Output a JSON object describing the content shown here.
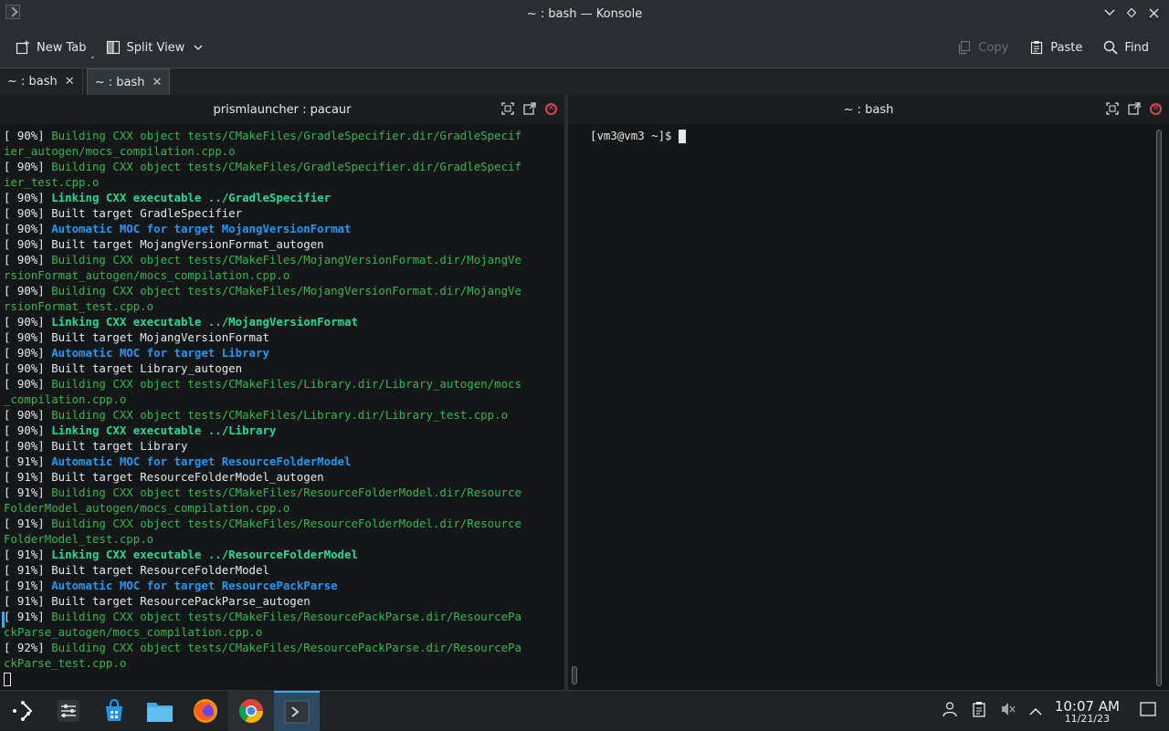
{
  "window": {
    "title": "~ : bash — Konsole"
  },
  "toolbar": {
    "new_tab": "New Tab",
    "split_view": "Split View",
    "copy": "Copy",
    "paste": "Paste",
    "find": "Find"
  },
  "tabs": [
    {
      "label": "~ : bash",
      "active": false
    },
    {
      "label": "~ : bash",
      "active": true
    }
  ],
  "left_pane": {
    "title": "prismlauncher : pacaur",
    "lines": [
      {
        "pct": "[ 90%] ",
        "text": "Building CXX object tests/CMakeFiles/GradleSpecifier.dir/GradleSpecif",
        "style": "g"
      },
      {
        "pct": "",
        "text": "ier_autogen/mocs_compilation.cpp.o",
        "style": "g"
      },
      {
        "pct": "[ 90%] ",
        "text": "Building CXX object tests/CMakeFiles/GradleSpecifier.dir/GradleSpecif",
        "style": "g"
      },
      {
        "pct": "",
        "text": "ier_test.cpp.o",
        "style": "g"
      },
      {
        "pct": "[ 90%] ",
        "text": "Linking CXX executable ../GradleSpecifier",
        "style": "gb"
      },
      {
        "pct": "[ 90%] ",
        "text": "Built target GradleSpecifier",
        "style": "w"
      },
      {
        "pct": "[ 90%] ",
        "text": "Automatic MOC for target MojangVersionFormat",
        "style": "bb"
      },
      {
        "pct": "[ 90%] ",
        "text": "Built target MojangVersionFormat_autogen",
        "style": "w"
      },
      {
        "pct": "[ 90%] ",
        "text": "Building CXX object tests/CMakeFiles/MojangVersionFormat.dir/MojangVe",
        "style": "g"
      },
      {
        "pct": "",
        "text": "rsionFormat_autogen/mocs_compilation.cpp.o",
        "style": "g"
      },
      {
        "pct": "[ 90%] ",
        "text": "Building CXX object tests/CMakeFiles/MojangVersionFormat.dir/MojangVe",
        "style": "g"
      },
      {
        "pct": "",
        "text": "rsionFormat_test.cpp.o",
        "style": "g"
      },
      {
        "pct": "[ 90%] ",
        "text": "Linking CXX executable ../MojangVersionFormat",
        "style": "gb"
      },
      {
        "pct": "[ 90%] ",
        "text": "Built target MojangVersionFormat",
        "style": "w"
      },
      {
        "pct": "[ 90%] ",
        "text": "Automatic MOC for target Library",
        "style": "bb"
      },
      {
        "pct": "[ 90%] ",
        "text": "Built target Library_autogen",
        "style": "w"
      },
      {
        "pct": "[ 90%] ",
        "text": "Building CXX object tests/CMakeFiles/Library.dir/Library_autogen/mocs",
        "style": "g"
      },
      {
        "pct": "",
        "text": "_compilation.cpp.o",
        "style": "g"
      },
      {
        "pct": "[ 90%] ",
        "text": "Building CXX object tests/CMakeFiles/Library.dir/Library_test.cpp.o",
        "style": "g"
      },
      {
        "pct": "[ 90%] ",
        "text": "Linking CXX executable ../Library",
        "style": "gb"
      },
      {
        "pct": "[ 90%] ",
        "text": "Built target Library",
        "style": "w"
      },
      {
        "pct": "[ 91%] ",
        "text": "Automatic MOC for target ResourceFolderModel",
        "style": "bb"
      },
      {
        "pct": "[ 91%] ",
        "text": "Built target ResourceFolderModel_autogen",
        "style": "w"
      },
      {
        "pct": "[ 91%] ",
        "text": "Building CXX object tests/CMakeFiles/ResourceFolderModel.dir/Resource",
        "style": "g"
      },
      {
        "pct": "",
        "text": "FolderModel_autogen/mocs_compilation.cpp.o",
        "style": "g"
      },
      {
        "pct": "[ 91%] ",
        "text": "Building CXX object tests/CMakeFiles/ResourceFolderModel.dir/Resource",
        "style": "g"
      },
      {
        "pct": "",
        "text": "FolderModel_test.cpp.o",
        "style": "g"
      },
      {
        "pct": "[ 91%] ",
        "text": "Linking CXX executable ../ResourceFolderModel",
        "style": "gb"
      },
      {
        "pct": "[ 91%] ",
        "text": "Built target ResourceFolderModel",
        "style": "w"
      },
      {
        "pct": "[ 91%] ",
        "text": "Automatic MOC for target ResourcePackParse",
        "style": "bb"
      },
      {
        "pct": "[ 91%] ",
        "text": "Built target ResourcePackParse_autogen",
        "style": "w"
      },
      {
        "pct": "[ 91%] ",
        "text": "Building CXX object tests/CMakeFiles/ResourcePackParse.dir/ResourcePa",
        "style": "g"
      },
      {
        "pct": "",
        "text": "ckParse_autogen/mocs_compilation.cpp.o",
        "style": "g"
      },
      {
        "pct": "[ 92%] ",
        "text": "Building CXX object tests/CMakeFiles/ResourcePackParse.dir/ResourcePa",
        "style": "g"
      },
      {
        "pct": "",
        "text": "ckParse_test.cpp.o",
        "style": "g"
      }
    ]
  },
  "right_pane": {
    "title": "~ : bash",
    "prompt": "[vm3@vm3 ~]$ "
  },
  "taskbar": {
    "time": "10:07 AM",
    "date": "11/21/23"
  },
  "colors": {
    "green": "#2fb84f",
    "bold_green": "#1cdc9a",
    "bold_blue": "#1d99f3",
    "accent": "#3daee9"
  }
}
